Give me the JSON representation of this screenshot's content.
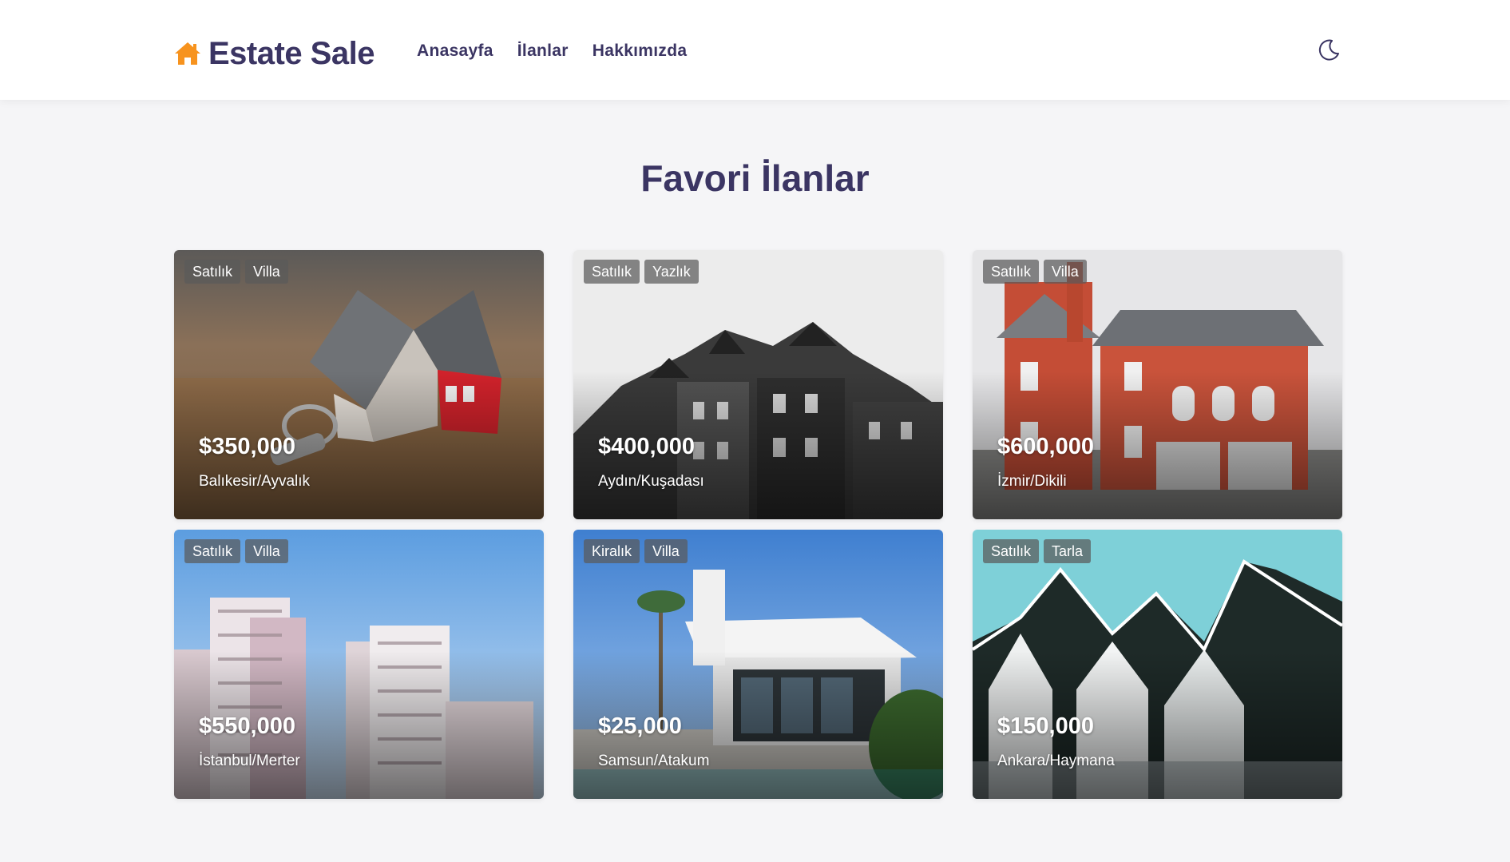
{
  "header": {
    "brand": "Estate Sale",
    "nav": [
      "Anasayfa",
      "İlanlar",
      "Hakkımızda"
    ],
    "brand_icon": "home-icon",
    "theme_icon": "moon-icon",
    "accent_color": "#f7931e",
    "text_color": "#3b3563"
  },
  "main": {
    "title": "Favori İlanlar"
  },
  "listings": [
    {
      "tags": [
        "Satılık",
        "Villa"
      ],
      "price": "$350,000",
      "location": "Balıkesir/Ayvalık",
      "scene": "toy house with keys on wooden table"
    },
    {
      "tags": [
        "Satılık",
        "Yazlık"
      ],
      "price": "$400,000",
      "location": "Aydın/Kuşadası",
      "scene": "black and white townhouses"
    },
    {
      "tags": [
        "Satılık",
        "Villa"
      ],
      "price": "$600,000",
      "location": "İzmir/Dikili",
      "scene": "red brick house with garage"
    },
    {
      "tags": [
        "Satılık",
        "Villa"
      ],
      "price": "$550,000",
      "location": "İstanbul/Merter",
      "scene": "tall residential towers"
    },
    {
      "tags": [
        "Kiralık",
        "Villa"
      ],
      "price": "$25,000",
      "location": "Samsun/Atakum",
      "scene": "modern white villa with palm"
    },
    {
      "tags": [
        "Satılık",
        "Tarla"
      ],
      "price": "$150,000",
      "location": "Ankara/Haymana",
      "scene": "gabled white houses against teal sky"
    }
  ]
}
